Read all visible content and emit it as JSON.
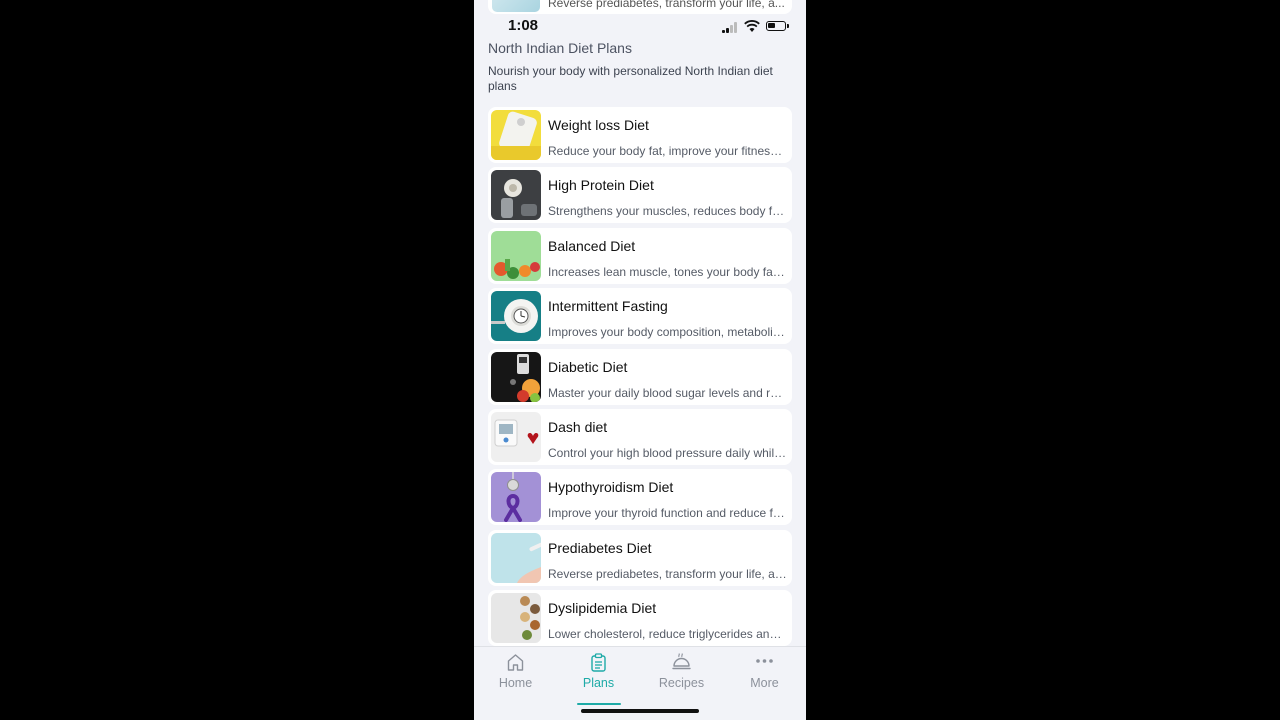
{
  "peek": {
    "desc": "Reverse prediabetes, transform your life, a..."
  },
  "status": {
    "time": "1:08"
  },
  "header": {
    "title": "North Indian Diet Plans",
    "subtitle": "Nourish your body with personalized North Indian diet plans"
  },
  "plans": [
    {
      "title": "Weight loss Diet",
      "desc": "Reduce your body fat, improve your fitness and health"
    },
    {
      "title": "High Protein Diet",
      "desc": "Strengthens your muscles, reduces body fat and cravings"
    },
    {
      "title": "Balanced Diet",
      "desc": "Increases lean muscle, tones your body fast and keeps you fit"
    },
    {
      "title": "Intermittent Fasting",
      "desc": "Improves your body composition, metabolism and energy"
    },
    {
      "title": "Diabetic Diet",
      "desc": "Master your daily blood sugar levels and reduce medication"
    },
    {
      "title": "Dash diet",
      "desc": "Control your high blood pressure daily while eating well"
    },
    {
      "title": "Hypothyroidism Diet",
      "desc": "Improve your thyroid function and reduce fatigue"
    },
    {
      "title": "Prediabetes Diet",
      "desc": "Reverse prediabetes, transform your life, and stay healthy"
    },
    {
      "title": "Dyslipidemia Diet",
      "desc": "Lower cholesterol, reduce triglycerides and protect your heart"
    }
  ],
  "tabs": [
    {
      "label": "Home",
      "icon": "home-icon",
      "active": false
    },
    {
      "label": "Plans",
      "icon": "clipboard-icon",
      "active": true
    },
    {
      "label": "Recipes",
      "icon": "dish-icon",
      "active": false
    },
    {
      "label": "More",
      "icon": "more-dots-icon",
      "active": false
    }
  ],
  "colors": {
    "accent": "#1eaaa7",
    "background": "#f2f3f8",
    "card": "#ffffff"
  }
}
